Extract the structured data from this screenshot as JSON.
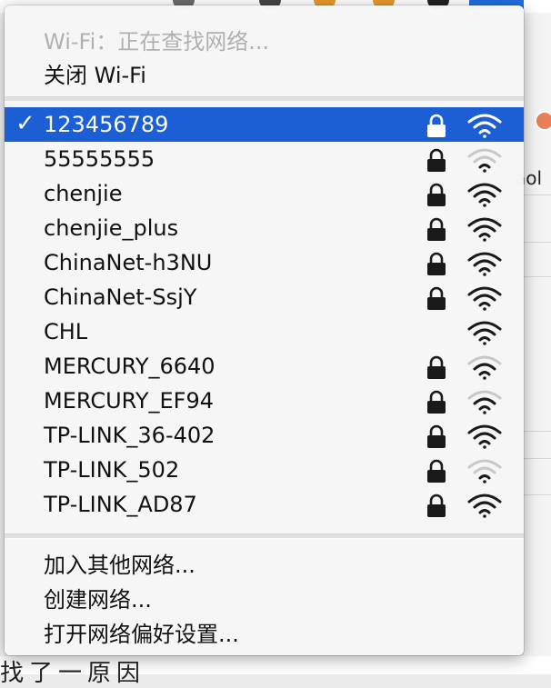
{
  "colors": {
    "selection": "#1c5fd4",
    "text": "#111111",
    "disabled": "#b0b0b0"
  },
  "menu": {
    "status": "Wi-Fi：正在查找网络...",
    "toggle": "关闭 Wi-Fi",
    "selected_mark": "✓",
    "networks": [
      {
        "name": "123456789",
        "locked": true,
        "signal": 3,
        "selected": true
      },
      {
        "name": "55555555",
        "locked": true,
        "signal": 1,
        "selected": false
      },
      {
        "name": "chenjie",
        "locked": true,
        "signal": 3,
        "selected": false
      },
      {
        "name": "chenjie_plus",
        "locked": true,
        "signal": 3,
        "selected": false
      },
      {
        "name": "ChinaNet-h3NU",
        "locked": true,
        "signal": 3,
        "selected": false
      },
      {
        "name": "ChinaNet-SsjY",
        "locked": true,
        "signal": 3,
        "selected": false
      },
      {
        "name": "CHL",
        "locked": false,
        "signal": 3,
        "selected": false
      },
      {
        "name": "MERCURY_6640",
        "locked": true,
        "signal": 2,
        "selected": false
      },
      {
        "name": "MERCURY_EF94",
        "locked": true,
        "signal": 2,
        "selected": false
      },
      {
        "name": "TP-LINK_36-402",
        "locked": true,
        "signal": 3,
        "selected": false
      },
      {
        "name": "TP-LINK_502",
        "locked": true,
        "signal": 1,
        "selected": false
      },
      {
        "name": "TP-LINK_AD87",
        "locked": true,
        "signal": 3,
        "selected": false
      }
    ],
    "join_other": "加入其他网络...",
    "create_network": "创建网络...",
    "open_preferences": "打开网络偏好设置..."
  },
  "background": {
    "right_cut_text": "aol",
    "bottom_cut_text": "找了一原因"
  }
}
